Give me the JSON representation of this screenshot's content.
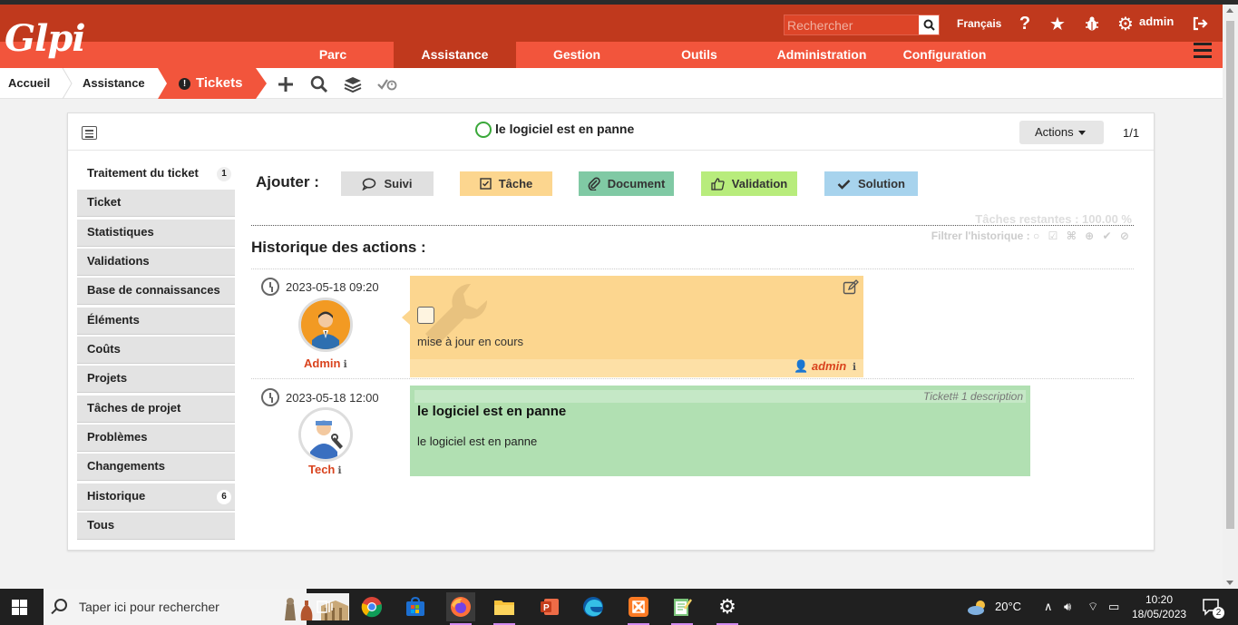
{
  "header": {
    "logo_text": "Glpi",
    "search_placeholder": "Rechercher",
    "language": "Français",
    "user": "admin"
  },
  "menu": [
    {
      "label": "Parc",
      "active": false
    },
    {
      "label": "Assistance",
      "active": true
    },
    {
      "label": "Gestion",
      "active": false
    },
    {
      "label": "Outils",
      "active": false
    },
    {
      "label": "Administration",
      "active": false
    },
    {
      "label": "Configuration",
      "active": false
    }
  ],
  "breadcrumb": {
    "home": "Accueil",
    "section": "Assistance",
    "current": "Tickets"
  },
  "ticket": {
    "title": "le logiciel est en panne",
    "actions_label": "Actions",
    "pager": "1/1"
  },
  "tabs": [
    {
      "label": "Traitement du ticket",
      "count": "1",
      "active": true
    },
    {
      "label": "Ticket",
      "count": "",
      "active": false
    },
    {
      "label": "Statistiques",
      "count": "",
      "active": false
    },
    {
      "label": "Validations",
      "count": "",
      "active": false
    },
    {
      "label": "Base de connaissances",
      "count": "",
      "active": false
    },
    {
      "label": "Éléments",
      "count": "",
      "active": false
    },
    {
      "label": "Coûts",
      "count": "",
      "active": false
    },
    {
      "label": "Projets",
      "count": "",
      "active": false
    },
    {
      "label": "Tâches de projet",
      "count": "",
      "active": false
    },
    {
      "label": "Problèmes",
      "count": "",
      "active": false
    },
    {
      "label": "Changements",
      "count": "",
      "active": false
    },
    {
      "label": "Historique",
      "count": "6",
      "active": false
    },
    {
      "label": "Tous",
      "count": "",
      "active": false
    }
  ],
  "add_section": {
    "label": "Ajouter :",
    "buttons": [
      {
        "label": "Suivi",
        "icon": "comment-icon",
        "color": "#e0e0e0"
      },
      {
        "label": "Tâche",
        "icon": "checkbox-icon",
        "color": "#fcd68f"
      },
      {
        "label": "Document",
        "icon": "paperclip-icon",
        "color": "#80c9a4"
      },
      {
        "label": "Validation",
        "icon": "thumbs-up-icon",
        "color": "#b8ec7c"
      },
      {
        "label": "Solution",
        "icon": "check-icon",
        "color": "#a7d3ed"
      }
    ]
  },
  "remaining_tasks": "Tâches restantes : 100.00 %",
  "filter_history": "Filtrer l'historique :",
  "history_title": "Historique des actions :",
  "timeline": [
    {
      "date": "2023-05-18 09:20",
      "user": "Admin",
      "type": "task",
      "text": "mise à jour en cours",
      "author": "admin"
    },
    {
      "date": "2023-05-18 12:00",
      "user": "Tech",
      "type": "description",
      "ref": "Ticket# 1 description",
      "title": "le logiciel est en panne",
      "text": "le logiciel est en panne"
    }
  ],
  "taskbar": {
    "search_placeholder": "Taper ici pour rechercher",
    "weather": "20°C",
    "time": "10:20",
    "date": "18/05/2023",
    "notifications": "2"
  }
}
